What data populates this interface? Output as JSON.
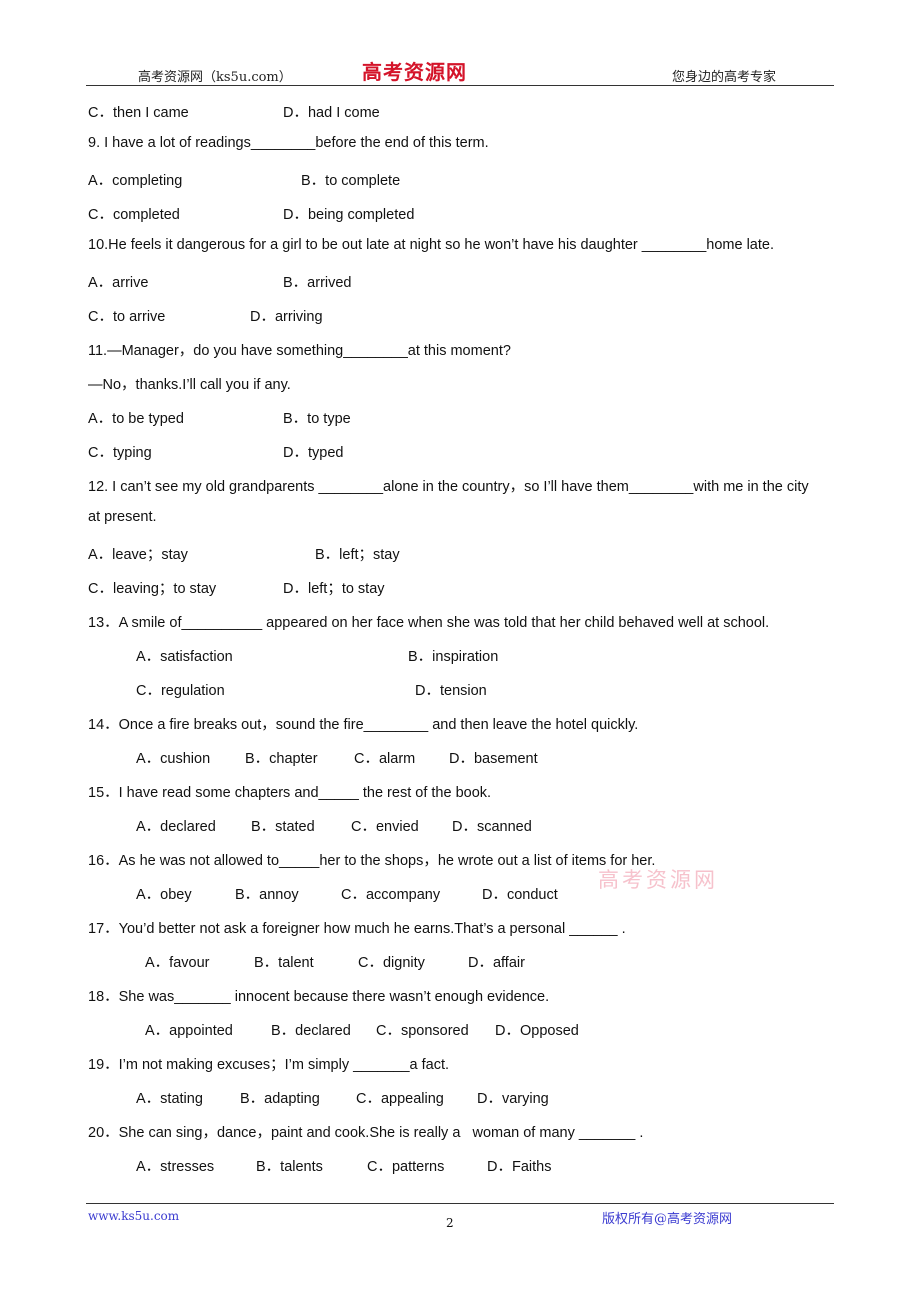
{
  "header": {
    "left": "高考资源网（ks5u.com）",
    "logo": "高考资源网",
    "right": "您身边的高考专家"
  },
  "q8_tail": {
    "options": [
      "C．then I came",
      "D．had I come"
    ]
  },
  "questions": [
    {
      "number": "9",
      "text": "9. I have a lot of readings________before the end of this term.",
      "options": [
        "A．completing",
        "B．to complete",
        "C．completed",
        "D．being completed"
      ]
    },
    {
      "number": "10",
      "text": "10.He feels it dangerous for a girl to be out late at night so he won’t have his daughter ________home late.",
      "options": [
        "A．arrive",
        "B．arrived",
        "C．to arrive",
        "D．arriving"
      ]
    },
    {
      "number": "11",
      "text": "11.—Manager，do you have something________at this moment?",
      "text2": "—No，thanks.I’ll call you if any.",
      "options": [
        "A．to be typed",
        "B．to type",
        "C．typing",
        "D．typed"
      ]
    },
    {
      "number": "12",
      "text": "12. I can’t see my old grandparents ________alone in the country，so I’ll have them________with me in the city",
      "text2": "at present.",
      "options": [
        "A．leave；stay",
        "B．left；stay",
        "C．leaving；to stay",
        "D．left；to stay"
      ]
    },
    {
      "number": "13",
      "text": "13．A smile of__________ appeared on her face when she was told that her child behaved well at school.",
      "options": [
        "A．satisfaction",
        "B．inspiration",
        "C．regulation",
        "D．tension"
      ]
    },
    {
      "number": "14",
      "text": "14．Once a fire breaks out，sound the fire________ and then leave the hotel quickly.",
      "options": [
        "A．cushion",
        "B．chapter",
        "C．alarm",
        "D．basement"
      ]
    },
    {
      "number": "15",
      "text": "15．I have read some chapters and_____ the rest of the book.",
      "options": [
        "A．declared",
        "B．stated",
        "C．envied",
        "D．scanned"
      ]
    },
    {
      "number": "16",
      "text": "16．As he was not allowed to_____her to the shops，he wrote out a list of items for her.",
      "options": [
        "A．obey",
        "B．annoy",
        "C．accompany",
        "D．conduct"
      ]
    },
    {
      "number": "17",
      "text": "17．You’d better not ask a foreigner how much he earns.That’s a personal ______ .",
      "options": [
        "A．favour",
        "B．talent",
        "C．dignity",
        "D．affair"
      ]
    },
    {
      "number": "18",
      "text": "18．She was_______ innocent because there wasn’t enough evidence.",
      "options": [
        "A．appointed",
        "B．declared",
        "C．sponsored",
        "D．Opposed"
      ]
    },
    {
      "number": "19",
      "text": "19．I’m not making excuses；I’m simply _______a fact.",
      "options": [
        "A．stating",
        "B．adapting",
        "C．appealing",
        "D．varying"
      ]
    },
    {
      "number": "20",
      "text": "20．She can sing，dance，paint and cook.She is really a   woman of many _______ .",
      "options": [
        "A．stresses",
        "B．talents",
        "C．patterns",
        "D．Faiths"
      ]
    }
  ],
  "watermark": "高考资源网",
  "footer": {
    "left": "www.ks5u.com",
    "page_number": "2",
    "right": "版权所有@高考资源网"
  }
}
